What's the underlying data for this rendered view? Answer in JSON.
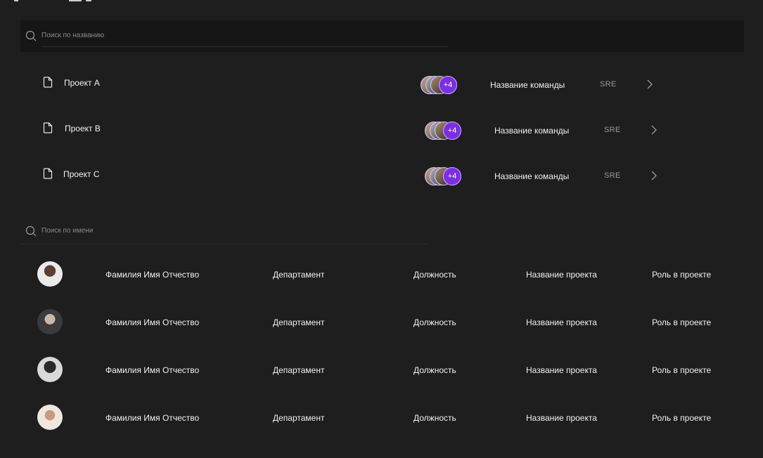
{
  "project_search": {
    "placeholder": "Поиск по названию"
  },
  "projects": [
    {
      "name": "Проект A",
      "more_members": "+4",
      "team_name": "Название команды",
      "team_tag": "SRE"
    },
    {
      "name": "Проект B",
      "more_members": "+4",
      "team_name": "Название команды",
      "team_tag": "SRE"
    },
    {
      "name": "Проект C",
      "more_members": "+4",
      "team_name": "Название команды",
      "team_tag": "SRE"
    }
  ],
  "people_search": {
    "placeholder": "Поиск по имени"
  },
  "people": [
    {
      "full_name": "Фамилия Имя Отчество",
      "department": "Департамент",
      "position": "Должность",
      "project": "Название проекта",
      "role": "Роль в проекте"
    },
    {
      "full_name": "Фамилия Имя Отчество",
      "department": "Департамент",
      "position": "Должность",
      "project": "Название проекта",
      "role": "Роль в проекте"
    },
    {
      "full_name": "Фамилия Имя Отчество",
      "department": "Департамент",
      "position": "Должность",
      "project": "Название проекта",
      "role": "Роль в проекте"
    },
    {
      "full_name": "Фамилия Имя Отчество",
      "department": "Департамент",
      "position": "Должность",
      "project": "Название проекта",
      "role": "Роль в проекте"
    }
  ],
  "colors": {
    "background": "#1e1e1f",
    "search_bg": "#161617",
    "accent_purple": "#7b2ee6",
    "text": "#f0f0f2",
    "muted": "#8a8a8f"
  }
}
